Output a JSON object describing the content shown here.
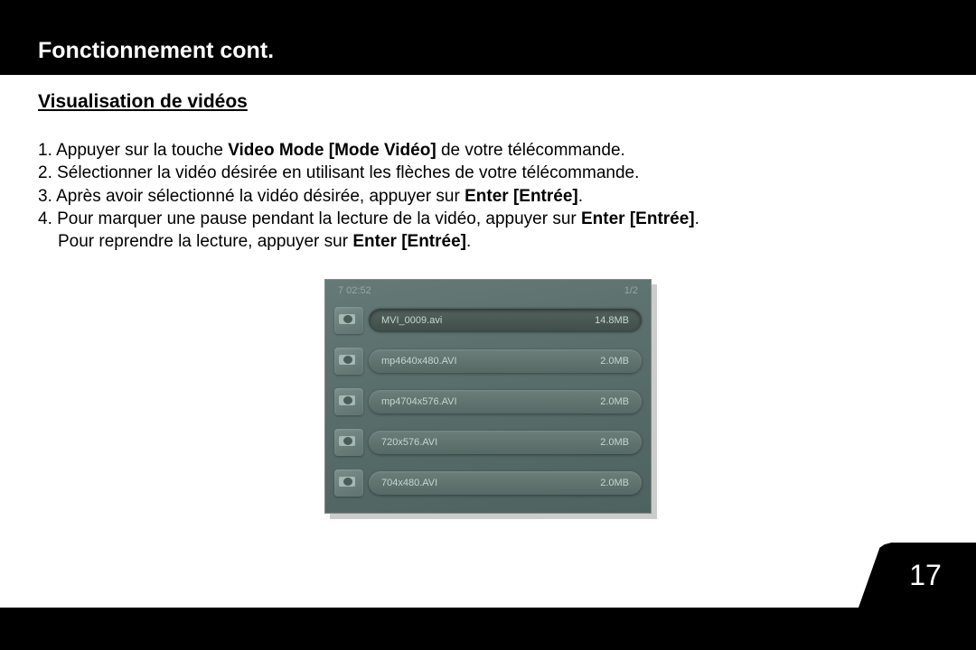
{
  "header": {
    "title": "Fonctionnement cont."
  },
  "subsection": {
    "title": "Visualisation de vidéos"
  },
  "instructions": {
    "item1_prefix": "1. Appuyer sur la touche ",
    "item1_bold": "Video Mode [Mode Vidéo]",
    "item1_suffix": " de votre télécommande.",
    "item2": "2. Sélectionner la vidéo désirée en utilisant les flèches de votre télécommande.",
    "item3_prefix": "3. Après avoir sélectionné la vidéo désirée, appuyer sur ",
    "item3_bold": "Enter [Entrée]",
    "item3_suffix": ".",
    "item4_prefix": "4. Pour marquer une pause pendant la lecture de la vidéo, appuyer sur ",
    "item4_bold": "Enter [Entrée]",
    "item4_suffix": ".",
    "item4b_prefix": "Pour reprendre la lecture, appuyer sur ",
    "item4b_bold": "Enter [Entrée]",
    "item4b_suffix": "."
  },
  "screenshot": {
    "top_left": "7   02:52",
    "top_right": "1/2",
    "files": [
      {
        "name": "MVI_0009.avi",
        "size": "14.8MB",
        "selected": true
      },
      {
        "name": "mp4640x480.AVI",
        "size": "2.0MB",
        "selected": false
      },
      {
        "name": "mp4704x576.AVI",
        "size": "2.0MB",
        "selected": false
      },
      {
        "name": "720x576.AVI",
        "size": "2.0MB",
        "selected": false
      },
      {
        "name": "704x480.AVI",
        "size": "2.0MB",
        "selected": false
      }
    ]
  },
  "page_number": "17"
}
